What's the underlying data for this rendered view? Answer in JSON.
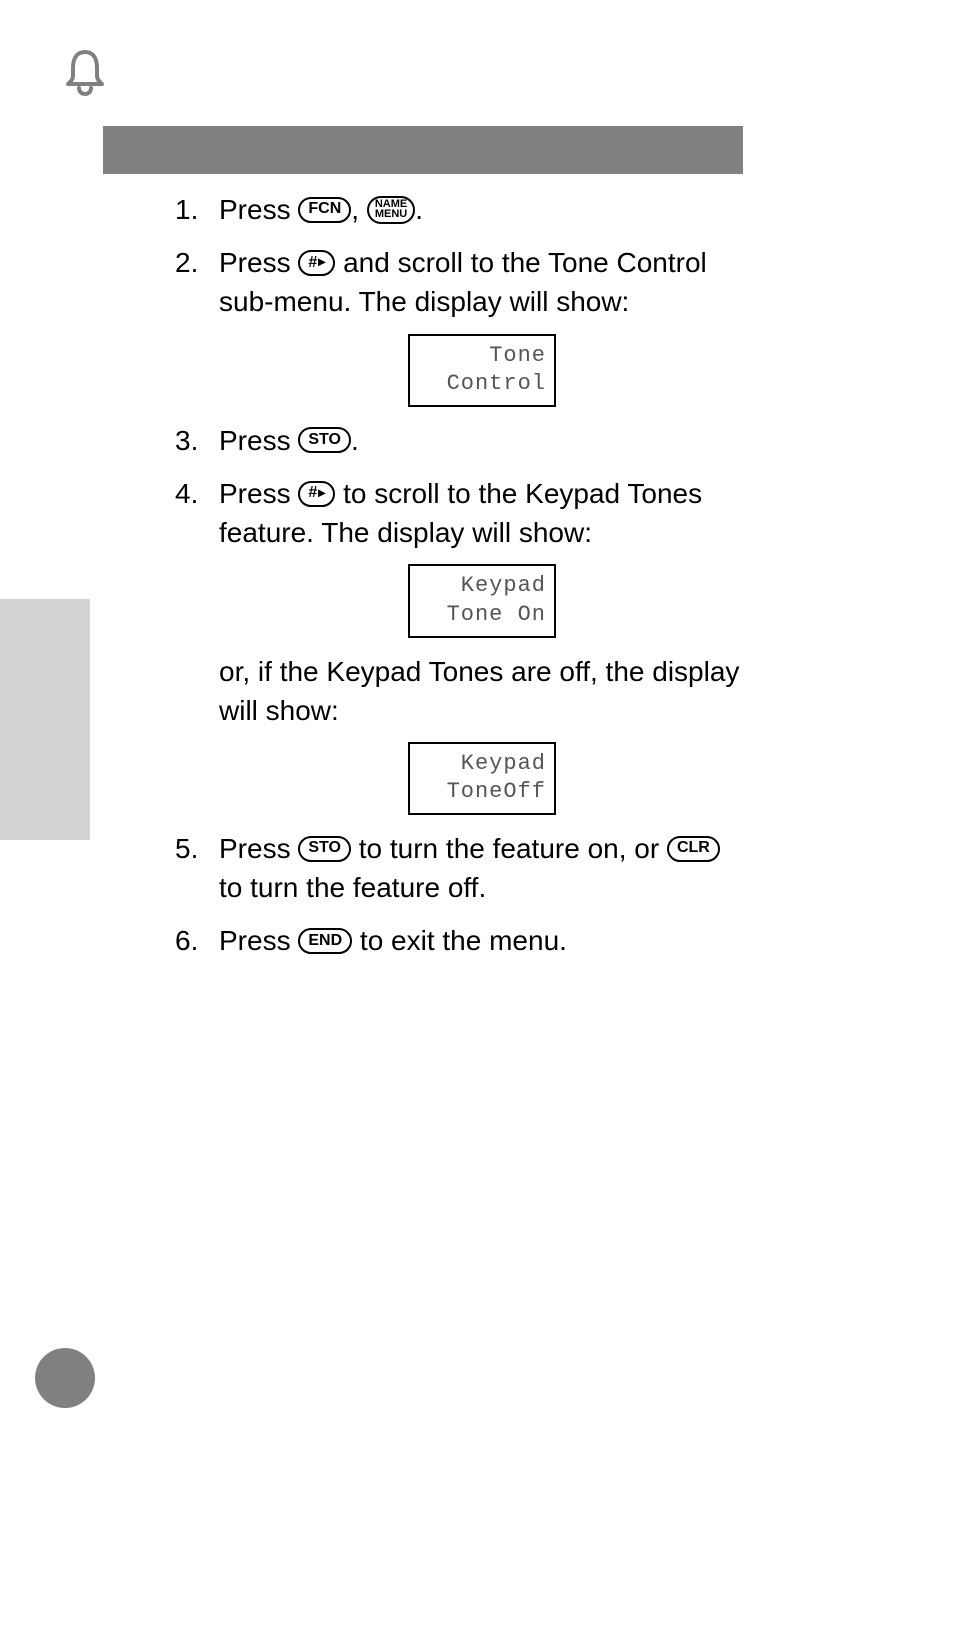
{
  "keys": {
    "fcn": "FCN",
    "name_top": "NAME",
    "name_bottom": "MENU",
    "hash": "#",
    "sto": "STO",
    "clr": "CLR",
    "end": "END"
  },
  "steps": {
    "s1_a": "Press ",
    "s1_b": ", ",
    "s1_c": ".",
    "s2_a": "Press ",
    "s2_b": " and scroll to the Tone Control sub-menu. The display will show:",
    "s3_a": "Press ",
    "s3_b": ".",
    "s4_a": "Press ",
    "s4_b": " to scroll to the Keypad Tones feature. The display will show:",
    "s4_c": "or, if the Keypad Tones are off, the display will show:",
    "s5_a": "Press ",
    "s5_b": " to turn the feature on, or ",
    "s5_c": " to turn the feature off.",
    "s6_a": "Press ",
    "s6_b": " to exit the menu."
  },
  "displays": {
    "d1_l1": "Tone",
    "d1_l2": "Control",
    "d2_l1": "Keypad",
    "d2_l2": "Tone On",
    "d3_l1": "Keypad",
    "d3_l2": "ToneOff"
  }
}
